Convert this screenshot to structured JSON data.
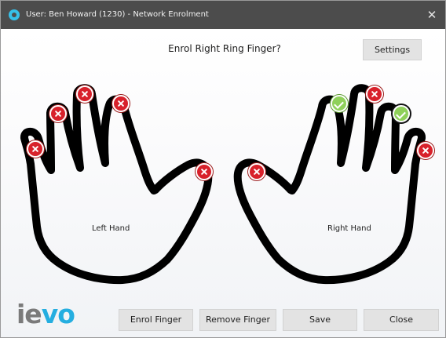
{
  "window": {
    "title": "User: Ben Howard (1230) - Network Enrolment"
  },
  "prompt": "Enrol Right Ring Finger?",
  "buttons": {
    "settings": "Settings",
    "enrol": "Enrol Finger",
    "remove": "Remove Finger",
    "save": "Save",
    "close": "Close"
  },
  "hands": {
    "left": {
      "label": "Left Hand",
      "fingers": [
        {
          "name": "thumb",
          "status": "not-enrolled"
        },
        {
          "name": "index",
          "status": "not-enrolled"
        },
        {
          "name": "middle",
          "status": "not-enrolled"
        },
        {
          "name": "ring",
          "status": "not-enrolled"
        },
        {
          "name": "little",
          "status": "not-enrolled"
        }
      ]
    },
    "right": {
      "label": "Right Hand",
      "fingers": [
        {
          "name": "thumb",
          "status": "not-enrolled"
        },
        {
          "name": "index",
          "status": "enrolled"
        },
        {
          "name": "middle",
          "status": "not-enrolled"
        },
        {
          "name": "ring",
          "status": "enrolled-selected"
        },
        {
          "name": "little",
          "status": "not-enrolled"
        }
      ]
    }
  },
  "logo": {
    "part1": "ie",
    "part2": "vo"
  },
  "colors": {
    "title_bar": "#4c4c4c",
    "not_enrolled": "#d8212b",
    "enrolled": "#8fd05a",
    "accent": "#25aee0"
  }
}
